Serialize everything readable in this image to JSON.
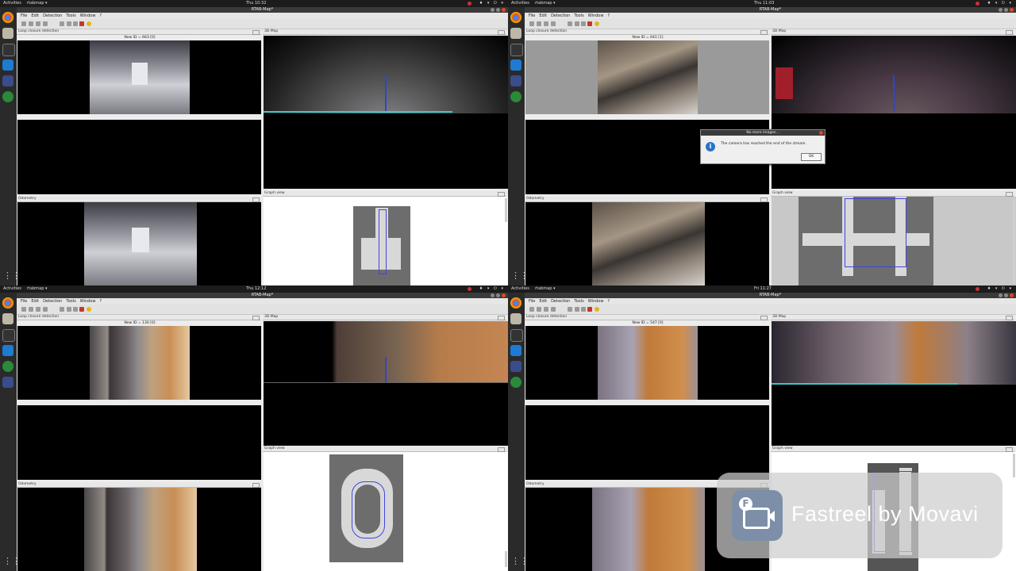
{
  "ui": {
    "activities": "Activities",
    "app_menu": "rtabmap ▾",
    "window_title": "RTAB-Map*",
    "menu": [
      "File",
      "Edit",
      "Detection",
      "Tools",
      "Window",
      "?"
    ],
    "panel_loop": "Loop closure detection",
    "panel_3d": "3D Map",
    "panel_odom": "Odometry",
    "panel_graph": "Graph view",
    "tray": "♦ ▾ ⏻ ▾"
  },
  "quadrants": [
    {
      "clock": "Thu 10:32",
      "new_id": "New ID = 663 [0]"
    },
    {
      "clock": "Thu 11:03",
      "new_id": "New ID = 641 [1]"
    },
    {
      "clock": "Thu 12:12",
      "new_id": "New ID = 130 [0]"
    },
    {
      "clock": "Fri 11:27",
      "new_id": "New ID = 547 [0]"
    }
  ],
  "dialog": {
    "title": "No more images...",
    "message": "The camera has reached the end of the stream.",
    "ok": "OK"
  },
  "watermark": {
    "text": "Fastreel by Movavi",
    "icon": "video-camera-icon"
  },
  "colors": {
    "trajectory": "#3d47e0",
    "ground": "#37c9c5",
    "close_button": "#e0452b",
    "record": "#c33333"
  }
}
